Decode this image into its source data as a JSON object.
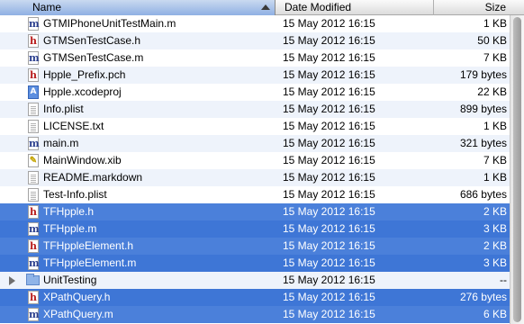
{
  "header": {
    "name_label": "Name",
    "date_label": "Date Modified",
    "size_label": "Size"
  },
  "files": [
    {
      "name": "GTMIPhoneUnitTestMain.m",
      "date": "15 May 2012 16:15",
      "size": "1 KB",
      "icon": "m-source-icon",
      "glyph": "m"
    },
    {
      "name": "GTMSenTestCase.h",
      "date": "15 May 2012 16:15",
      "size": "50 KB",
      "icon": "h-header-icon",
      "glyph": "h"
    },
    {
      "name": "GTMSenTestCase.m",
      "date": "15 May 2012 16:15",
      "size": "7 KB",
      "icon": "m-source-icon",
      "glyph": "m"
    },
    {
      "name": "Hpple_Prefix.pch",
      "date": "15 May 2012 16:15",
      "size": "179 bytes",
      "icon": "h-header-icon",
      "glyph": "h"
    },
    {
      "name": "Hpple.xcodeproj",
      "date": "15 May 2012 16:15",
      "size": "22 KB",
      "icon": "xcodeproj-icon",
      "glyph": "A"
    },
    {
      "name": "Info.plist",
      "date": "15 May 2012 16:15",
      "size": "899 bytes",
      "icon": "document-icon",
      "glyph": ""
    },
    {
      "name": "LICENSE.txt",
      "date": "15 May 2012 16:15",
      "size": "1 KB",
      "icon": "document-icon",
      "glyph": ""
    },
    {
      "name": "main.m",
      "date": "15 May 2012 16:15",
      "size": "321 bytes",
      "icon": "m-source-icon",
      "glyph": "m"
    },
    {
      "name": "MainWindow.xib",
      "date": "15 May 2012 16:15",
      "size": "7 KB",
      "icon": "xib-icon",
      "glyph": "✎"
    },
    {
      "name": "README.markdown",
      "date": "15 May 2012 16:15",
      "size": "1 KB",
      "icon": "document-icon",
      "glyph": ""
    },
    {
      "name": "Test-Info.plist",
      "date": "15 May 2012 16:15",
      "size": "686 bytes",
      "icon": "document-icon",
      "glyph": ""
    },
    {
      "name": "TFHpple.h",
      "date": "15 May 2012 16:15",
      "size": "2 KB",
      "icon": "h-header-icon",
      "glyph": "h"
    },
    {
      "name": "TFHpple.m",
      "date": "15 May 2012 16:15",
      "size": "3 KB",
      "icon": "m-source-icon",
      "glyph": "m"
    },
    {
      "name": "TFHppleElement.h",
      "date": "15 May 2012 16:15",
      "size": "2 KB",
      "icon": "h-header-icon",
      "glyph": "h"
    },
    {
      "name": "TFHppleElement.m",
      "date": "15 May 2012 16:15",
      "size": "3 KB",
      "icon": "m-source-icon",
      "glyph": "m"
    },
    {
      "name": "UnitTesting",
      "date": "15 May 2012 16:15",
      "size": "--",
      "icon": "folder-icon",
      "glyph": "",
      "folder": true
    },
    {
      "name": "XPathQuery.h",
      "date": "15 May 2012 16:15",
      "size": "276 bytes",
      "icon": "h-header-icon",
      "glyph": "h"
    },
    {
      "name": "XPathQuery.m",
      "date": "15 May 2012 16:15",
      "size": "6 KB",
      "icon": "m-source-icon",
      "glyph": "m"
    }
  ],
  "selected_rows": [
    11,
    12,
    13,
    14,
    16,
    17
  ],
  "colors": {
    "selection": "#3e76d6",
    "row_alternate": "#eef3fb",
    "header_sorted": "#8fb0e3"
  }
}
